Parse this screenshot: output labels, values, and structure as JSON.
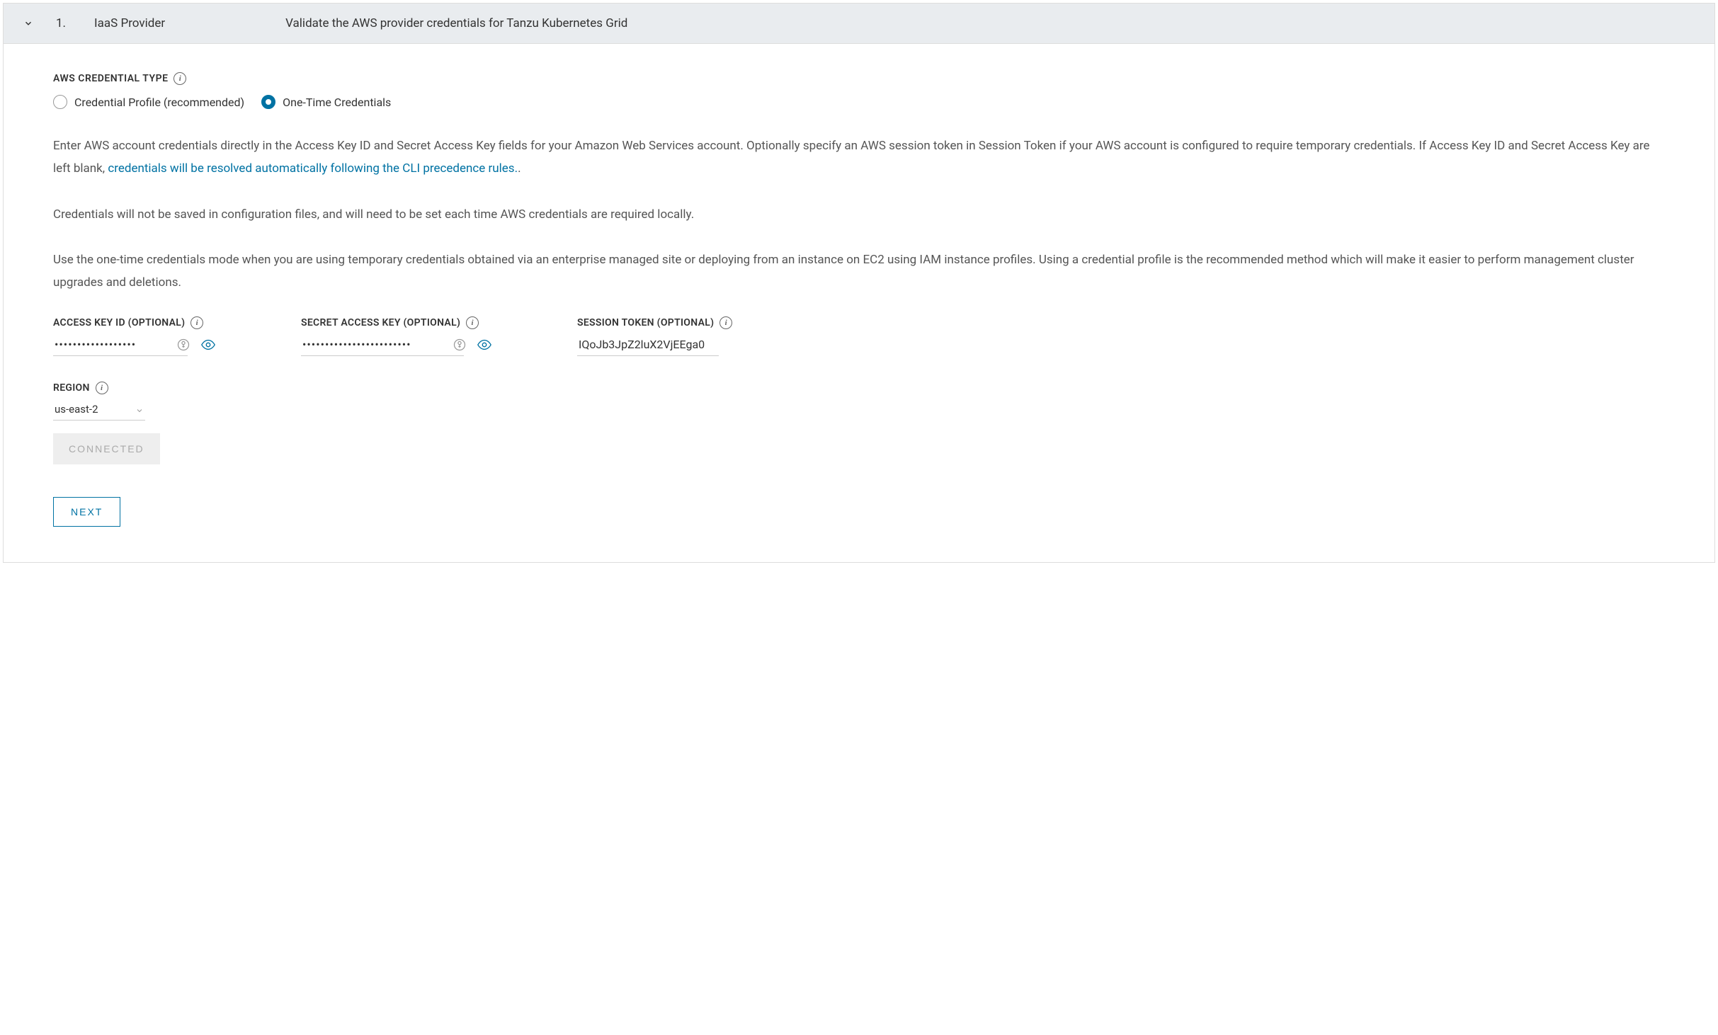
{
  "header": {
    "step_number": "1.",
    "step_title": "IaaS Provider",
    "step_description": "Validate the AWS provider credentials for Tanzu Kubernetes Grid"
  },
  "credential_type": {
    "label": "AWS CREDENTIAL TYPE",
    "options": {
      "profile": "Credential Profile (recommended)",
      "one_time": "One-Time Credentials"
    }
  },
  "description": {
    "p1_prefix": "Enter AWS account credentials directly in the Access Key ID and Secret Access Key fields for your Amazon Web Services account. Optionally specify an AWS session token in Session Token if your AWS account is configured to require temporary credentials. If Access Key ID and Secret Access Key are left blank, ",
    "p1_link": "credentials will be resolved automatically following the CLI precedence rules.",
    "p1_suffix": ".",
    "p2": "Credentials will not be saved in configuration files, and will need to be set each time AWS credentials are required locally.",
    "p3": "Use the one-time credentials mode when you are using temporary credentials obtained via an enterprise managed site or deploying from an instance on EC2 using IAM instance profiles. Using a credential profile is the recommended method which will make it easier to perform management cluster upgrades and deletions."
  },
  "fields": {
    "access_key": {
      "label": "ACCESS KEY ID (OPTIONAL)",
      "value": "••••••••••••••••••"
    },
    "secret_key": {
      "label": "SECRET ACCESS KEY (OPTIONAL)",
      "value": "••••••••••••••••••••••••"
    },
    "session_token": {
      "label": "SESSION TOKEN (OPTIONAL)",
      "value": "IQoJb3JpZ2luX2VjEEga0"
    },
    "region": {
      "label": "REGION",
      "value": "us-east-2"
    }
  },
  "buttons": {
    "connected": "CONNECTED",
    "next": "NEXT"
  }
}
